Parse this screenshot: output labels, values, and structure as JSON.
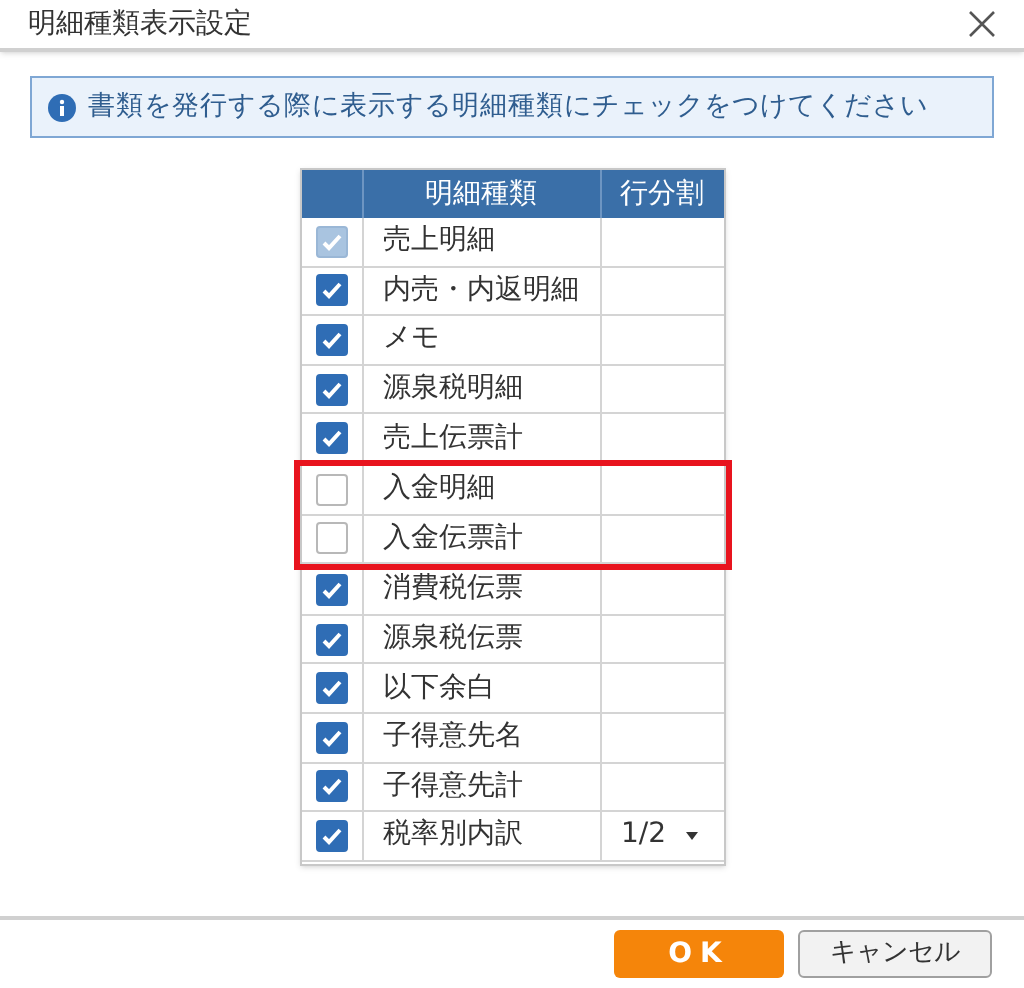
{
  "window": {
    "title": "明細種類表示設定"
  },
  "info": "書類を発行する際に表示する明細種類にチェックをつけてください",
  "table": {
    "columns": [
      "明細種類",
      "行分割"
    ],
    "rows": [
      {
        "name": "売上明細",
        "checked": true,
        "disabled": true,
        "highlighted": false
      },
      {
        "name": "内売・内返明細",
        "checked": true,
        "disabled": false,
        "highlighted": false
      },
      {
        "name": "メモ",
        "checked": true,
        "disabled": false,
        "highlighted": false
      },
      {
        "name": "源泉税明細",
        "checked": true,
        "disabled": false,
        "highlighted": false
      },
      {
        "name": "売上伝票計",
        "checked": true,
        "disabled": false,
        "highlighted": false
      },
      {
        "name": "入金明細",
        "checked": false,
        "disabled": false,
        "highlighted": true
      },
      {
        "name": "入金伝票計",
        "checked": false,
        "disabled": false,
        "highlighted": true
      },
      {
        "name": "消費税伝票",
        "checked": true,
        "disabled": false,
        "highlighted": false
      },
      {
        "name": "源泉税伝票",
        "checked": true,
        "disabled": false,
        "highlighted": false
      },
      {
        "name": "以下余白",
        "checked": true,
        "disabled": false,
        "highlighted": false
      },
      {
        "name": "子得意先名",
        "checked": true,
        "disabled": false,
        "highlighted": false
      },
      {
        "name": "子得意先計",
        "checked": true,
        "disabled": false,
        "highlighted": false
      },
      {
        "name": "税率別内訳",
        "checked": true,
        "disabled": false,
        "highlighted": false,
        "split": "1/2"
      }
    ]
  },
  "buttons": {
    "ok": "OK",
    "cancel": "キャンセル"
  }
}
